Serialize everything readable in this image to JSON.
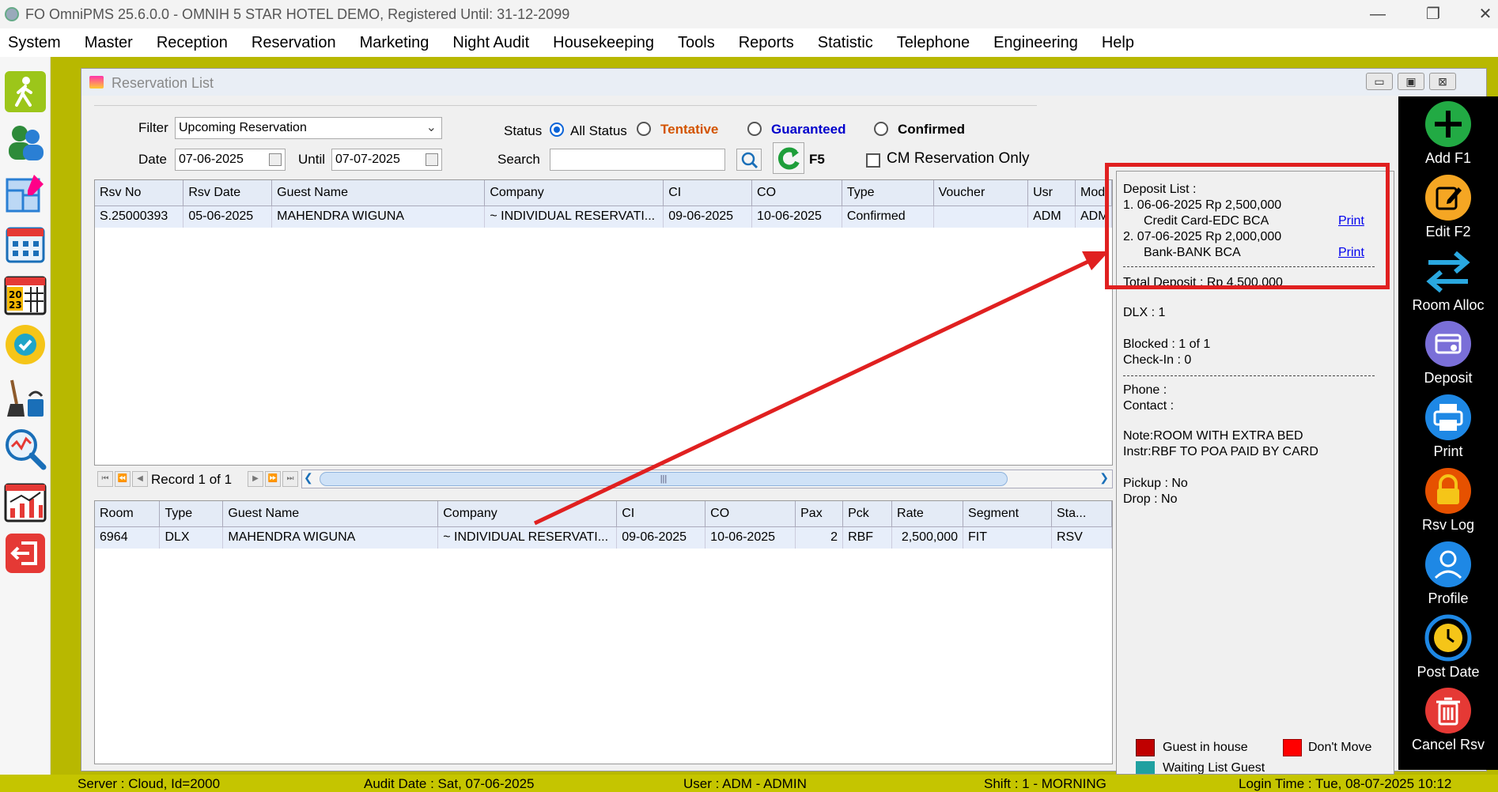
{
  "window": {
    "title": "FO OmniPMS 25.6.0.0 - OMNIH 5 STAR HOTEL DEMO, Registered Until: 31-12-2099",
    "minimize_glyph": "—",
    "restore_glyph": "❐",
    "close_glyph": "✕"
  },
  "menu": [
    "System",
    "Master",
    "Reception",
    "Reservation",
    "Marketing",
    "Night Audit",
    "Housekeeping",
    "Tools",
    "Reports",
    "Statistic",
    "Telephone",
    "Engineering",
    "Help"
  ],
  "left_icons": [
    "walk-in-icon",
    "guests-icon",
    "room-plan-icon",
    "calendar-icon",
    "calendar-2023-icon",
    "availability-icon",
    "housekeeping-icon",
    "analysis-icon",
    "statistic-chart-icon",
    "exit-icon"
  ],
  "rsv_window": {
    "title": "Reservation List",
    "filter_label": "Filter",
    "filter_value": "Upcoming Reservation",
    "date_label": "Date",
    "date_value": "07-06-2025",
    "until_label": "Until",
    "until_value": "07-07-2025",
    "status_label": "Status",
    "status_options": [
      {
        "label": "All Status",
        "selected": true,
        "color": "#000000"
      },
      {
        "label": "Tentative",
        "selected": false,
        "color": "#d35400"
      },
      {
        "label": "Guaranteed",
        "selected": false,
        "color": "#0000cc"
      },
      {
        "label": "Confirmed",
        "selected": false,
        "color": "#000000"
      }
    ],
    "search_label": "Search",
    "search_value": "",
    "refresh_key": "F5",
    "cm_only_label": "CM Reservation Only"
  },
  "rsv_grid": {
    "columns": [
      "Rsv No",
      "Rsv Date",
      "Guest Name",
      "Company",
      "CI",
      "CO",
      "Type",
      "Voucher",
      "Usr",
      "Mod"
    ],
    "rows": [
      [
        "S.25000393",
        "05-06-2025",
        "MAHENDRA WIGUNA",
        "~ INDIVIDUAL RESERVATI...",
        "09-06-2025",
        "10-06-2025",
        "Confirmed",
        "",
        "ADM",
        "ADM"
      ]
    ]
  },
  "navigator": {
    "record_text": "Record 1 of 1",
    "scroll_grip": "|||"
  },
  "room_grid": {
    "columns": [
      "Room",
      "Type",
      "Guest Name",
      "Company",
      "CI",
      "CO",
      "Pax",
      "Pck",
      "Rate",
      "Segment",
      "Sta..."
    ],
    "rows": [
      [
        "6964",
        "DLX",
        "MAHENDRA WIGUNA",
        "~ INDIVIDUAL RESERVATI...",
        "09-06-2025",
        "10-06-2025",
        "2",
        "RBF",
        "2,500,000",
        "FIT",
        "RSV"
      ]
    ]
  },
  "info": {
    "deposit_title": "Deposit List :",
    "deposits": [
      {
        "line": "1. 06-06-2025   Rp 2,500,000",
        "method": "Credit Card-EDC BCA",
        "print": "Print"
      },
      {
        "line": "2. 07-06-2025   Rp 2,000,000",
        "method": "Bank-BANK BCA",
        "print": "Print"
      }
    ],
    "total_deposit": "Total Deposit : Rp 4,500,000",
    "room_type_count": "DLX : 1",
    "blocked": "Blocked : 1 of 1",
    "checkin": "Check-In : 0",
    "phone": "Phone :",
    "contact": "Contact :",
    "note": "Note:ROOM WITH EXTRA BED",
    "instr": "Instr:RBF TO POA PAID BY CARD",
    "pickup": "Pickup : No",
    "drop": "Drop : No",
    "legend": [
      {
        "label": "Guest in house",
        "color": "#c00000"
      },
      {
        "label": "Don't Move",
        "color": "#ff0000"
      },
      {
        "label": "Waiting List Guest",
        "color": "#20a0a0"
      }
    ]
  },
  "toolbar": [
    {
      "label": "Add F1",
      "icon": "add-icon",
      "color": "#22aa44"
    },
    {
      "label": "Edit F2",
      "icon": "edit-icon",
      "color": "#f5a623"
    },
    {
      "label": "Room Alloc",
      "icon": "room-alloc-icon",
      "color": "#2aa8e0"
    },
    {
      "label": "Deposit",
      "icon": "deposit-icon",
      "color": "#7a6fd8"
    },
    {
      "label": "Print",
      "icon": "print-icon",
      "color": "#1e88e5"
    },
    {
      "label": "Rsv Log",
      "icon": "lock-icon",
      "color": "#e65100"
    },
    {
      "label": "Profile",
      "icon": "profile-icon",
      "color": "#1e88e5"
    },
    {
      "label": "Post Date",
      "icon": "clock-icon",
      "color": "#1e88e5"
    },
    {
      "label": "Cancel Rsv",
      "icon": "trash-icon",
      "color": "#e53935"
    }
  ],
  "status": {
    "server": "Server : Cloud, Id=2000",
    "audit": "Audit Date : Sat, 07-06-2025",
    "user": "User : ADM - ADMIN",
    "shift": "Shift : 1 - MORNING",
    "login": "Login Time : Tue, 08-07-2025 10:12"
  },
  "colors": {
    "annotation": "#e02020",
    "workspace": "#b8b800",
    "statusbar": "#c5c500"
  }
}
